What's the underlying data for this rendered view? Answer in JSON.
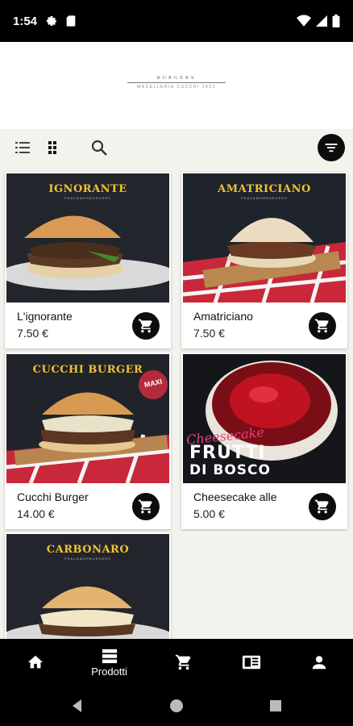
{
  "status_bar": {
    "time": "1:54",
    "icons": [
      "gear-icon",
      "sd-card-icon",
      "wifi-icon",
      "cell-signal-icon",
      "battery-icon"
    ]
  },
  "header": {
    "logo_top": "BURGERS",
    "logo_sub": "MACELLERIA CUCCHI 1921"
  },
  "toolbar": {
    "icons": [
      "list-view-icon",
      "grid-view-icon",
      "search-icon",
      "filter-icon"
    ]
  },
  "products": [
    {
      "name": "L'ignorante",
      "price": "7.50 €",
      "banner": "IGNORANTE",
      "banner_sub": "PEAC&MORBURGERS"
    },
    {
      "name": "Amatriciano",
      "price": "7.50 €",
      "banner": "AMATRICIANO",
      "banner_sub": "PEAC&MORBURGERS"
    },
    {
      "name": "Cucchi Burger",
      "price": "14.00 €",
      "banner": "CUCCHI BURGER",
      "badge": "MAXI"
    },
    {
      "name": "Cheesecake alle",
      "price": "5.00 €",
      "script": "Cheesecake",
      "title_line1": "FRUTTI",
      "title_line2": "DI BOSCO"
    },
    {
      "banner": "CARBONARO",
      "banner_sub": "PEAC&MORBURGERS"
    }
  ],
  "bottom_nav": {
    "products_label": "Prodotti",
    "icons": [
      "home-icon",
      "products-icon",
      "cart-icon",
      "news-icon",
      "profile-icon"
    ]
  },
  "colors": {
    "accent": "#0d0d0d",
    "banner_yellow": "#f2c230",
    "background": "#f3f3ee"
  }
}
